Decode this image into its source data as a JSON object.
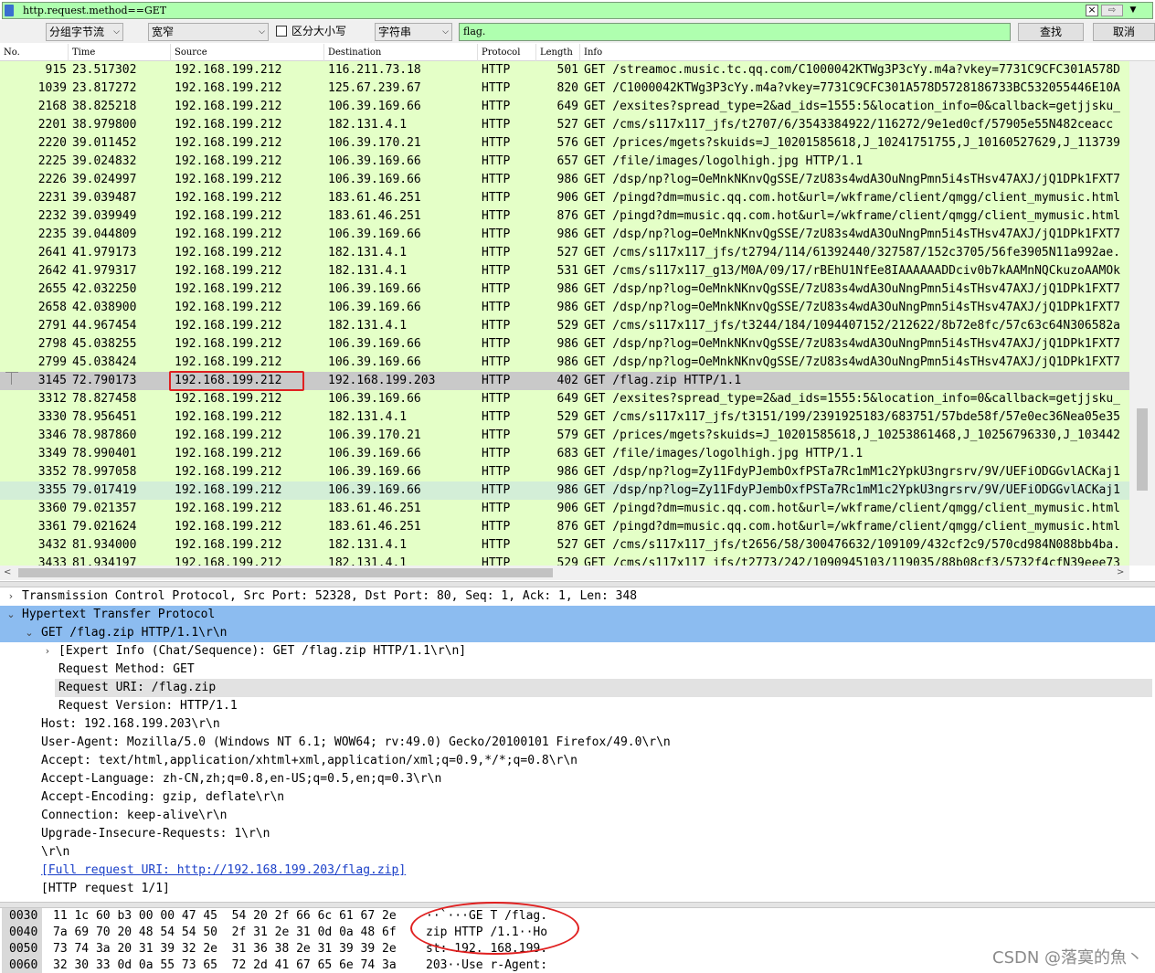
{
  "filter": {
    "text": "http.request.method==GET",
    "clear_icon": "close-icon",
    "apply_icon": "arrow-right-icon",
    "dropdown_icon": "chevron-down-icon"
  },
  "search": {
    "search_in": "分组字节流",
    "charset": "宽窄",
    "case_sensitive_label": "区分大小写",
    "type": "字符串",
    "query": "flag.",
    "find_label": "查找",
    "cancel_label": "取消"
  },
  "packet_list": {
    "columns": [
      "No.",
      "Time",
      "Source",
      "Destination",
      "Protocol",
      "Length",
      "Info"
    ],
    "rows": [
      {
        "no": "915",
        "time": "23.517302",
        "src": "192.168.199.212",
        "dst": "116.211.73.18",
        "proto": "HTTP",
        "len": "501",
        "info": "GET /streamoc.music.tc.qq.com/C1000042KTWg3P3cYy.m4a?vkey=7731C9CFC301A578D"
      },
      {
        "no": "1039",
        "time": "23.817272",
        "src": "192.168.199.212",
        "dst": "125.67.239.67",
        "proto": "HTTP",
        "len": "820",
        "info": "GET /C1000042KTWg3P3cYy.m4a?vkey=7731C9CFC301A578D5728186733BC532055446E10A"
      },
      {
        "no": "2168",
        "time": "38.825218",
        "src": "192.168.199.212",
        "dst": "106.39.169.66",
        "proto": "HTTP",
        "len": "649",
        "info": "GET /exsites?spread_type=2&ad_ids=1555:5&location_info=0&callback=getjjsku_"
      },
      {
        "no": "2201",
        "time": "38.979800",
        "src": "192.168.199.212",
        "dst": "182.131.4.1",
        "proto": "HTTP",
        "len": "527",
        "info": "GET /cms/s117x117_jfs/t2707/6/3543384922/116272/9e1ed0cf/57905e55N482ceacc"
      },
      {
        "no": "2220",
        "time": "39.011452",
        "src": "192.168.199.212",
        "dst": "106.39.170.21",
        "proto": "HTTP",
        "len": "576",
        "info": "GET /prices/mgets?skuids=J_10201585618,J_10241751755,J_10160527629,J_113739"
      },
      {
        "no": "2225",
        "time": "39.024832",
        "src": "192.168.199.212",
        "dst": "106.39.169.66",
        "proto": "HTTP",
        "len": "657",
        "info": "GET /file/images/logolhigh.jpg HTTP/1.1"
      },
      {
        "no": "2226",
        "time": "39.024997",
        "src": "192.168.199.212",
        "dst": "106.39.169.66",
        "proto": "HTTP",
        "len": "986",
        "info": "GET /dsp/np?log=OeMnkNKnvQgSSE/7zU83s4wdA3OuNngPmn5i4sTHsv47AXJ/jQ1DPk1FXT7"
      },
      {
        "no": "2231",
        "time": "39.039487",
        "src": "192.168.199.212",
        "dst": "183.61.46.251",
        "proto": "HTTP",
        "len": "906",
        "info": "GET /pingd?dm=music.qq.com.hot&url=/wkframe/client/qmgg/client_mymusic.html"
      },
      {
        "no": "2232",
        "time": "39.039949",
        "src": "192.168.199.212",
        "dst": "183.61.46.251",
        "proto": "HTTP",
        "len": "876",
        "info": "GET /pingd?dm=music.qq.com.hot&url=/wkframe/client/qmgg/client_mymusic.html"
      },
      {
        "no": "2235",
        "time": "39.044809",
        "src": "192.168.199.212",
        "dst": "106.39.169.66",
        "proto": "HTTP",
        "len": "986",
        "info": "GET /dsp/np?log=OeMnkNKnvQgSSE/7zU83s4wdA3OuNngPmn5i4sTHsv47AXJ/jQ1DPk1FXT7"
      },
      {
        "no": "2641",
        "time": "41.979173",
        "src": "192.168.199.212",
        "dst": "182.131.4.1",
        "proto": "HTTP",
        "len": "527",
        "info": "GET /cms/s117x117_jfs/t2794/114/61392440/327587/152c3705/56fe3905N11a992ae."
      },
      {
        "no": "2642",
        "time": "41.979317",
        "src": "192.168.199.212",
        "dst": "182.131.4.1",
        "proto": "HTTP",
        "len": "531",
        "info": "GET /cms/s117x117_g13/M0A/09/17/rBEhU1NfEe8IAAAAAADDciv0b7kAAMnNQCkuzoAAMOk"
      },
      {
        "no": "2655",
        "time": "42.032250",
        "src": "192.168.199.212",
        "dst": "106.39.169.66",
        "proto": "HTTP",
        "len": "986",
        "info": "GET /dsp/np?log=OeMnkNKnvQgSSE/7zU83s4wdA3OuNngPmn5i4sTHsv47AXJ/jQ1DPk1FXT7"
      },
      {
        "no": "2658",
        "time": "42.038900",
        "src": "192.168.199.212",
        "dst": "106.39.169.66",
        "proto": "HTTP",
        "len": "986",
        "info": "GET /dsp/np?log=OeMnkNKnvQgSSE/7zU83s4wdA3OuNngPmn5i4sTHsv47AXJ/jQ1DPk1FXT7"
      },
      {
        "no": "2791",
        "time": "44.967454",
        "src": "192.168.199.212",
        "dst": "182.131.4.1",
        "proto": "HTTP",
        "len": "529",
        "info": "GET /cms/s117x117_jfs/t3244/184/1094407152/212622/8b72e8fc/57c63c64N306582a"
      },
      {
        "no": "2798",
        "time": "45.038255",
        "src": "192.168.199.212",
        "dst": "106.39.169.66",
        "proto": "HTTP",
        "len": "986",
        "info": "GET /dsp/np?log=OeMnkNKnvQgSSE/7zU83s4wdA3OuNngPmn5i4sTHsv47AXJ/jQ1DPk1FXT7"
      },
      {
        "no": "2799",
        "time": "45.038424",
        "src": "192.168.199.212",
        "dst": "106.39.169.66",
        "proto": "HTTP",
        "len": "986",
        "info": "GET /dsp/np?log=OeMnkNKnvQgSSE/7zU83s4wdA3OuNngPmn5i4sTHsv47AXJ/jQ1DPk1FXT7"
      },
      {
        "no": "3145",
        "time": "72.790173",
        "src": "192.168.199.212",
        "dst": "192.168.199.203",
        "proto": "HTTP",
        "len": "402",
        "info": "GET /flag.zip HTTP/1.1",
        "selected": true
      },
      {
        "no": "3312",
        "time": "78.827458",
        "src": "192.168.199.212",
        "dst": "106.39.169.66",
        "proto": "HTTP",
        "len": "649",
        "info": "GET /exsites?spread_type=2&ad_ids=1555:5&location_info=0&callback=getjjsku_"
      },
      {
        "no": "3330",
        "time": "78.956451",
        "src": "192.168.199.212",
        "dst": "182.131.4.1",
        "proto": "HTTP",
        "len": "529",
        "info": "GET /cms/s117x117_jfs/t3151/199/2391925183/683751/57bde58f/57e0ec36Nea05e35"
      },
      {
        "no": "3346",
        "time": "78.987860",
        "src": "192.168.199.212",
        "dst": "106.39.170.21",
        "proto": "HTTP",
        "len": "579",
        "info": "GET /prices/mgets?skuids=J_10201585618,J_10253861468,J_10256796330,J_103442"
      },
      {
        "no": "3349",
        "time": "78.990401",
        "src": "192.168.199.212",
        "dst": "106.39.169.66",
        "proto": "HTTP",
        "len": "683",
        "info": "GET /file/images/logolhigh.jpg HTTP/1.1"
      },
      {
        "no": "3352",
        "time": "78.997058",
        "src": "192.168.199.212",
        "dst": "106.39.169.66",
        "proto": "HTTP",
        "len": "986",
        "info": "GET /dsp/np?log=Zy11FdyPJembOxfPSTa7Rc1mM1c2YpkU3ngrsrv/9V/UEFiODGGvlACKaj1"
      },
      {
        "no": "3355",
        "time": "79.017419",
        "src": "192.168.199.212",
        "dst": "106.39.169.66",
        "proto": "HTTP",
        "len": "986",
        "info": "GET /dsp/np?log=Zy11FdyPJembOxfPSTa7Rc1mM1c2YpkU3ngrsrv/9V/UEFiODGGvlACKaj1",
        "alt": true
      },
      {
        "no": "3360",
        "time": "79.021357",
        "src": "192.168.199.212",
        "dst": "183.61.46.251",
        "proto": "HTTP",
        "len": "906",
        "info": "GET /pingd?dm=music.qq.com.hot&url=/wkframe/client/qmgg/client_mymusic.html"
      },
      {
        "no": "3361",
        "time": "79.021624",
        "src": "192.168.199.212",
        "dst": "183.61.46.251",
        "proto": "HTTP",
        "len": "876",
        "info": "GET /pingd?dm=music.qq.com.hot&url=/wkframe/client/qmgg/client_mymusic.html"
      },
      {
        "no": "3432",
        "time": "81.934000",
        "src": "192.168.199.212",
        "dst": "182.131.4.1",
        "proto": "HTTP",
        "len": "527",
        "info": "GET /cms/s117x117_jfs/t2656/58/300476632/109109/432cf2c9/570cd984N088bb4ba."
      },
      {
        "no": "3433",
        "time": "81.934197",
        "src": "192.168.199.212",
        "dst": "182.131.4.1",
        "proto": "HTTP",
        "len": "529",
        "info": "GET /cms/s117x117_jfs/t2773/242/1090945103/119035/88b08cf3/5732f4cfN39eee73"
      }
    ]
  },
  "details": [
    {
      "twisty": ">",
      "text": "Transmission Control Protocol, Src Port: 52328, Dst Port: 80, Seq: 1, Ack: 1, Len: 348",
      "level": 0
    },
    {
      "twisty": "v",
      "text": "Hypertext Transfer Protocol",
      "level": 0,
      "highlight": "blue"
    },
    {
      "twisty": "v",
      "text": "GET /flag.zip HTTP/1.1\\r\\n",
      "level": 1,
      "highlight": "blue"
    },
    {
      "twisty": ">",
      "text": "[Expert Info (Chat/Sequence): GET /flag.zip HTTP/1.1\\r\\n]",
      "level": 2
    },
    {
      "twisty": "",
      "text": "Request Method: GET",
      "level": 2
    },
    {
      "twisty": "",
      "text": "Request URI: /flag.zip",
      "level": 2,
      "highlight": "gray"
    },
    {
      "twisty": "",
      "text": "Request Version: HTTP/1.1",
      "level": 2
    },
    {
      "twisty": "",
      "text": "Host: 192.168.199.203\\r\\n",
      "level": 1
    },
    {
      "twisty": "",
      "text": "User-Agent: Mozilla/5.0 (Windows NT 6.1; WOW64; rv:49.0) Gecko/20100101 Firefox/49.0\\r\\n",
      "level": 1
    },
    {
      "twisty": "",
      "text": "Accept: text/html,application/xhtml+xml,application/xml;q=0.9,*/*;q=0.8\\r\\n",
      "level": 1
    },
    {
      "twisty": "",
      "text": "Accept-Language: zh-CN,zh;q=0.8,en-US;q=0.5,en;q=0.3\\r\\n",
      "level": 1
    },
    {
      "twisty": "",
      "text": "Accept-Encoding: gzip, deflate\\r\\n",
      "level": 1
    },
    {
      "twisty": "",
      "text": "Connection: keep-alive\\r\\n",
      "level": 1
    },
    {
      "twisty": "",
      "text": "Upgrade-Insecure-Requests: 1\\r\\n",
      "level": 1
    },
    {
      "twisty": "",
      "text": "\\r\\n",
      "level": 1
    },
    {
      "twisty": "",
      "text": "[Full request URI: http://192.168.199.203/flag.zip]",
      "level": 1,
      "link": true
    },
    {
      "twisty": "",
      "text": "[HTTP request 1/1]",
      "level": 1
    }
  ],
  "hex": [
    {
      "offset": "0030",
      "bytes": "11 1c 60 b3 00 00 47 45  54 20 2f 66 6c 61 67 2e",
      "ascii": "··`···GE T /flag."
    },
    {
      "offset": "0040",
      "bytes": "7a 69 70 20 48 54 54 50  2f 31 2e 31 0d 0a 48 6f",
      "ascii": "zip HTTP /1.1··Ho"
    },
    {
      "offset": "0050",
      "bytes": "73 74 3a 20 31 39 32 2e  31 36 38 2e 31 39 39 2e",
      "ascii": "st: 192. 168.199."
    },
    {
      "offset": "0060",
      "bytes": "32 30 33 0d 0a 55 73 65  72 2d 41 67 65 6e 74 3a",
      "ascii": "203··Use r-Agent:"
    }
  ],
  "watermark": "CSDN @落寞的魚丶",
  "colors": {
    "filter_bg": "#afffaf",
    "http_row_bg": "#e4ffc7",
    "selected_row_bg": "#c9c9c9",
    "detail_highlight": "#8cbcf0",
    "annotation_red": "#e02020"
  }
}
